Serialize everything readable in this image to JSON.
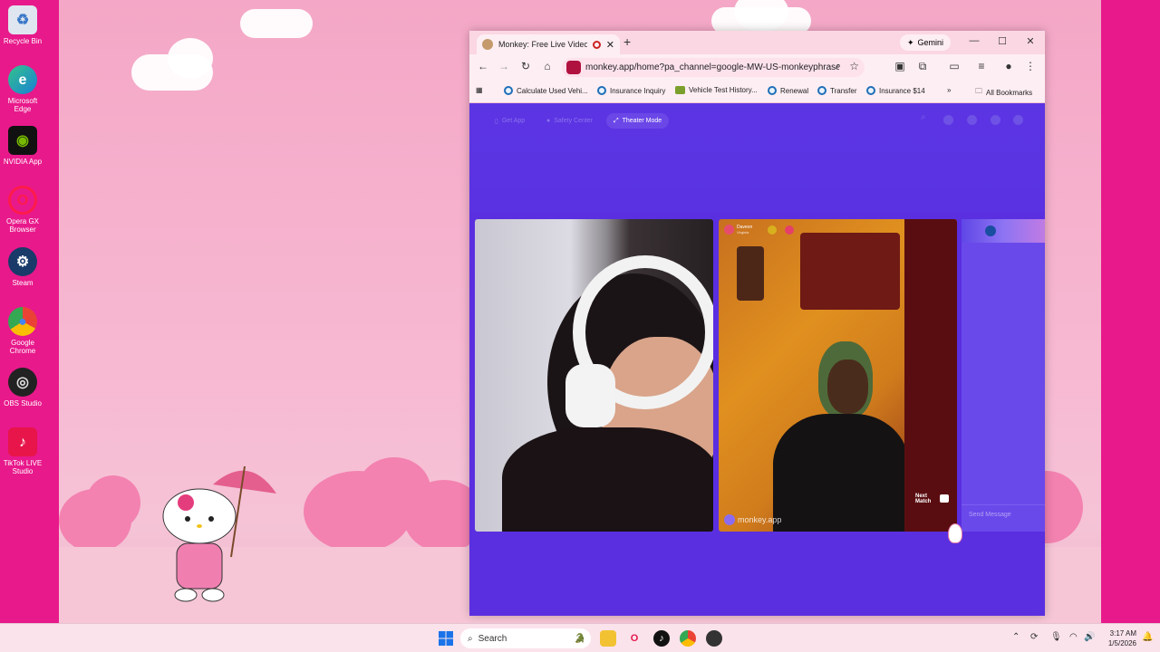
{
  "desktop": {
    "icons": [
      {
        "label": "Recycle Bin"
      },
      {
        "label": "Microsoft Edge"
      },
      {
        "label": "NVIDIA App"
      },
      {
        "label": "Opera GX Browser"
      },
      {
        "label": "Steam"
      },
      {
        "label": "Google Chrome"
      },
      {
        "label": "OBS Studio"
      },
      {
        "label": "TikTok LIVE Studio"
      }
    ]
  },
  "browser": {
    "tab_title": "Monkey: Free Live Video Ch",
    "gemini_label": "Gemini",
    "url": "monkey.app/home?pa_channel=google-MW-US-monkeyphrase&...",
    "bookmarks": [
      {
        "label": "Calculate Used Vehi..."
      },
      {
        "label": "Insurance Inquiry"
      },
      {
        "label": "Vehicle Test History..."
      },
      {
        "label": "Renewal"
      },
      {
        "label": "Transfer"
      },
      {
        "label": "Insurance $14"
      }
    ],
    "all_bookmarks": "All Bookmarks"
  },
  "page": {
    "nav": {
      "get_app": "Get App",
      "safety_center": "Safety Center",
      "theater_mode": "Theater Mode"
    },
    "remote_user": {
      "name": "Daveon",
      "location": "Virginia"
    },
    "next_match": [
      "Next",
      "Match"
    ],
    "watermark": "monkey.app",
    "send_message": "Send Message"
  },
  "taskbar": {
    "search_label": "Search",
    "time": "3:17 AM",
    "date": "1/5/2026"
  }
}
